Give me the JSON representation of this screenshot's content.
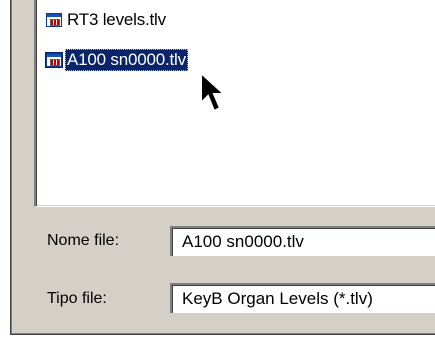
{
  "file_list": {
    "items": [
      {
        "name": "RT3 levels.tlv",
        "icon": "tlv-file-icon",
        "selected": false
      },
      {
        "name": "A100 sn0000.tlv",
        "icon": "tlv-file-icon",
        "selected": true
      }
    ]
  },
  "form": {
    "filename_label": "Nome file:",
    "filename_value": "A100 sn0000.tlv",
    "filetype_label": "Tipo file:",
    "filetype_value": "KeyB Organ Levels (*.tlv)"
  },
  "colors": {
    "selection": "#0a246a",
    "dialog_face": "#d4d0c8"
  }
}
